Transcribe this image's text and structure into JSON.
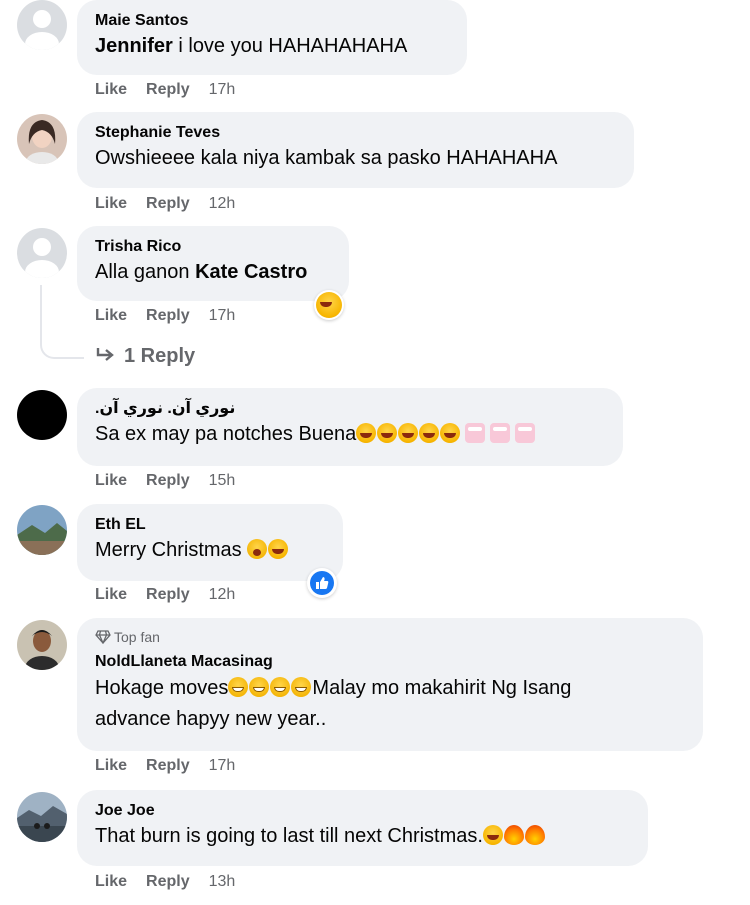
{
  "actions": {
    "like": "Like",
    "reply": "Reply"
  },
  "comments": [
    {
      "author": "Maie Santos",
      "tag": "Jennifer",
      "text": " i love you HAHAHAHAHA",
      "time": "17h"
    },
    {
      "author": "Stephanie Teves",
      "text": "Owshieeee kala niya kambak sa pasko HAHAHAHA",
      "time": "12h"
    },
    {
      "author": "Trisha Rico",
      "text": "Alla ganon ",
      "tag": "Kate Castro",
      "time": "17h",
      "replies_label": "1 Reply"
    },
    {
      "author": "نوري آن. نوري آن.",
      "text": "Sa ex may pa notches Buena",
      "time": "15h"
    },
    {
      "author": "Eth EL",
      "text": "Merry Christmas ",
      "time": "12h"
    },
    {
      "badge": "Top fan",
      "author": "NoldLlaneta Macasinag",
      "text_line1": "Hokage moves",
      "text_line1b": "Malay mo makahirit Ng Isang",
      "text_line2": "advance hapyy new year..",
      "time": "17h"
    },
    {
      "author": "Joe Joe",
      "text": "That burn is going to last till next Christmas.",
      "time": "13h"
    }
  ],
  "icons": {
    "default_avatar": "default-avatar-icon",
    "reply_arrow": "reply-arrow-icon",
    "diamond": "top-fan-diamond-icon",
    "like_reaction": "like-reaction-icon",
    "haha_reaction": "haha-reaction-icon"
  }
}
